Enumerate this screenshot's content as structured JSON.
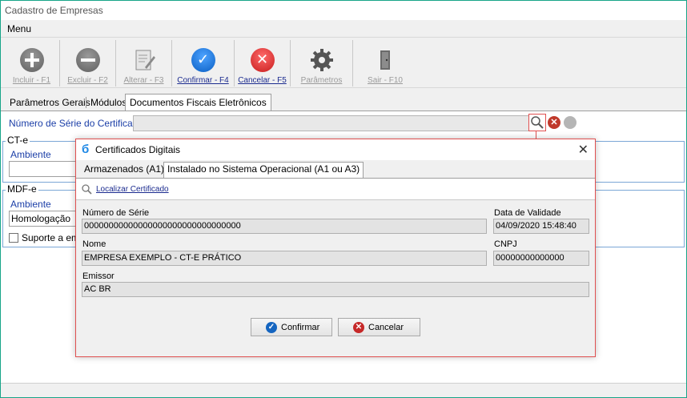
{
  "window": {
    "title": "Cadastro de Empresas"
  },
  "menu": {
    "label": "Menu"
  },
  "toolbar": {
    "incluir": "Incluir - F1",
    "excluir": "Excluir - F2",
    "alterar": "Alterar - F3",
    "confirmar": "Confirmar - F4",
    "cancelar": "Cancelar - F5",
    "parametros": "Parâmetros",
    "sair": "Sair - F10"
  },
  "tabs": [
    "Parâmetros Gerais",
    "Módulos",
    "Documentos Fiscais Eletrônicos"
  ],
  "form": {
    "serie_label": "Número de Série do Certificado",
    "serie_value": "",
    "cte": {
      "title": "CT-e",
      "ambiente_label": "Ambiente",
      "ambiente_value": ""
    },
    "mdfe": {
      "title": "MDF-e",
      "ambiente_label": "Ambiente",
      "ambiente_value": "Homologação",
      "suporte_label": "Suporte a emis"
    }
  },
  "dialog": {
    "title": "Certificados Digitais",
    "close": "✕",
    "tabs": [
      "Armazenados (A1)",
      "Instalado no Sistema Operacional (A1 ou A3)"
    ],
    "localizar": "Localizar Certificado",
    "numero_serie_label": "Número de Série",
    "numero_serie_value": "00000000000000000000000000000000",
    "validade_label": "Data de Validade",
    "validade_value": "04/09/2020 15:48:40",
    "nome_label": "Nome",
    "nome_value": "EMPRESA EXEMPLO - CT-E PRÁTICO",
    "cnpj_label": "CNPJ",
    "cnpj_value": "00000000000000",
    "emissor_label": "Emissor",
    "emissor_value": "AC BR",
    "confirmar": "Confirmar",
    "cancelar": "Cancelar"
  },
  "colors": {
    "accent": "#1b3ea7",
    "dialog_border": "#e05050",
    "confirm_blue": "#0b5fc4",
    "cancel_red": "#c71d1d"
  }
}
